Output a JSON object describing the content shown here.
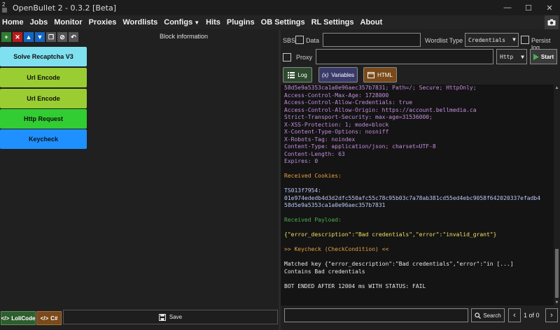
{
  "window": {
    "title": "OpenBullet 2 - 0.3.2 [Beta]",
    "controls": [
      "—",
      "☐",
      "✕"
    ]
  },
  "menu": [
    {
      "label": "Home"
    },
    {
      "label": "Jobs"
    },
    {
      "label": "Monitor"
    },
    {
      "label": "Proxies"
    },
    {
      "label": "Wordlists"
    },
    {
      "label": "Configs",
      "has_dropdown": true
    },
    {
      "label": "Hits"
    },
    {
      "label": "Plugins"
    },
    {
      "label": "OB Settings"
    },
    {
      "label": "RL Settings"
    },
    {
      "label": "About"
    }
  ],
  "left": {
    "toolbar": [
      {
        "glyph": "+",
        "icon": "add-icon",
        "color": "#2e7d32"
      },
      {
        "glyph": "✕",
        "icon": "remove-icon",
        "color": "#b71c1c"
      },
      {
        "glyph": "▲",
        "icon": "move-up-icon",
        "color": "#1565c0"
      },
      {
        "glyph": "▼",
        "icon": "move-down-icon",
        "color": "#1565c0"
      },
      {
        "glyph": "❐",
        "icon": "clone-icon",
        "color": "#555555"
      },
      {
        "glyph": "⊘",
        "icon": "disable-icon",
        "color": "#555555"
      },
      {
        "glyph": "↶",
        "icon": "undo-icon",
        "color": "#555555"
      }
    ],
    "block_info_label": "Block information",
    "blocks": [
      {
        "label": "Solve Recaptcha V3",
        "color": "#7fe0f0"
      },
      {
        "label": "Url Encode",
        "color": "#9acd32"
      },
      {
        "label": "Url Encode",
        "color": "#9acd32"
      },
      {
        "label": "Http Request",
        "color": "#32cd32"
      },
      {
        "label": "Keycheck",
        "color": "#1e90ff"
      }
    ],
    "bottom_tabs": [
      {
        "label": "LoliCode",
        "icon": "code-icon",
        "color": "#2e5e2e"
      },
      {
        "label": "C#",
        "icon": "code-icon",
        "color": "#7a4a1a"
      }
    ],
    "save_label": "Save"
  },
  "right": {
    "sbs_label": "SBS",
    "data_label": "Data",
    "data_value": "",
    "wordlist_type_label": "Wordlist Type",
    "wordlist_type_value": "Credentials",
    "persist_log_label": "Persist log",
    "proxy_label": "Proxy",
    "proxy_value": "",
    "proxy_type_value": "Http",
    "start_label": "Start",
    "view_buttons": [
      {
        "label": "Log",
        "icon": "list-icon",
        "color": "#2e4a2e"
      },
      {
        "label": "Variables",
        "icon": "variables-icon",
        "color": "#3a3a6a"
      },
      {
        "label": "HTML",
        "icon": "html-icon",
        "color": "#7a4a1a"
      }
    ],
    "log": [
      {
        "text": "58d5e9a5353ca1a0e96aec357b7831; Path=/; Secure; HttpOnly;",
        "color": "purple"
      },
      {
        "text": "Access-Control-Max-Age: 1728000",
        "color": "purple"
      },
      {
        "text": "Access-Control-Allow-Credentials: true",
        "color": "purple"
      },
      {
        "text": "Access-Control-Allow-Origin: https://account.bellmedia.ca",
        "color": "purple"
      },
      {
        "text": "Strict-Transport-Security: max-age=31536000;",
        "color": "purple"
      },
      {
        "text": "X-XSS-Protection: 1; mode=block",
        "color": "purple"
      },
      {
        "text": "X-Content-Type-Options: nosniff",
        "color": "purple"
      },
      {
        "text": "X-Robots-Tag: noindex",
        "color": "purple"
      },
      {
        "text": "Content-Type: application/json; charset=UTF-8",
        "color": "purple"
      },
      {
        "text": "Content-Length: 63",
        "color": "purple"
      },
      {
        "text": "Expires: 0",
        "color": "purple"
      },
      {
        "text": "",
        "color": "white"
      },
      {
        "text": "Received Cookies:",
        "color": "orange"
      },
      {
        "text": "",
        "color": "white"
      },
      {
        "text": "TS013f7954:",
        "color": "blue"
      },
      {
        "text": "01e974ededb4d3d2dfc550afc55c78c95b03c7a78ab381cd55ed4ebc9058f642020337efadb4",
        "color": "blue"
      },
      {
        "text": "58d5e9a5353ca1a0e96aec357b7831",
        "color": "blue"
      },
      {
        "text": "",
        "color": "white"
      },
      {
        "text": "Received Payload:",
        "color": "green"
      },
      {
        "text": "",
        "color": "white"
      },
      {
        "text": "{\"error_description\":\"Bad credentials\",\"error\":\"invalid_grant\"}",
        "color": "yellow"
      },
      {
        "text": "",
        "color": "white"
      },
      {
        "text": ">> Keycheck (CheckCondition) <<",
        "color": "orange"
      },
      {
        "text": "",
        "color": "white"
      },
      {
        "text": "Matched key {\"error_description\":\"Bad credentials\",\"error\":\"in [...]",
        "color": "white"
      },
      {
        "text": "Contains Bad credentials",
        "color": "white"
      },
      {
        "text": "",
        "color": "white"
      },
      {
        "text": "BOT ENDED AFTER 12004 ms WITH STATUS: FAIL",
        "color": "white"
      }
    ],
    "search_placeholder": "",
    "search_label": "Search",
    "page_text": "1 of 0"
  }
}
